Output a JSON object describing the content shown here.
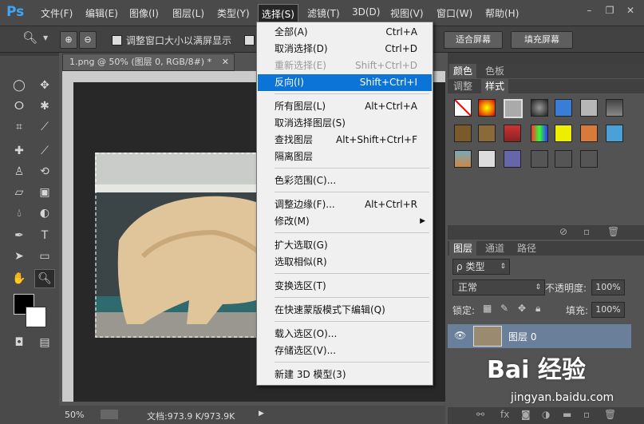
{
  "app": {
    "logo": "Ps"
  },
  "menubar": {
    "items": [
      "文件(F)",
      "编辑(E)",
      "图像(I)",
      "图层(L)",
      "类型(Y)",
      "选择(S)",
      "滤镜(T)",
      "3D(D)",
      "视图(V)",
      "窗口(W)",
      "帮助(H)"
    ]
  },
  "optbar": {
    "fit_label": "调整窗口大小以满屏显示",
    "fill_screen_btn": "适合屏幕",
    "fill_btn": "填充屏幕"
  },
  "document": {
    "tab_title": "1.png @ 50% (图层 0, RGB/8#) *",
    "zoom": "50%",
    "doc_info": "文档:973.9 K/973.9K"
  },
  "select_menu": {
    "items": [
      {
        "label": "全部(A)",
        "shortcut": "Ctrl+A",
        "state": "normal"
      },
      {
        "label": "取消选择(D)",
        "shortcut": "Ctrl+D",
        "state": "normal"
      },
      {
        "label": "重新选择(E)",
        "shortcut": "Shift+Ctrl+D",
        "state": "disabled"
      },
      {
        "label": "反向(I)",
        "shortcut": "Shift+Ctrl+I",
        "state": "highlighted"
      },
      {
        "label": "所有图层(L)",
        "shortcut": "Alt+Ctrl+A",
        "state": "normal"
      },
      {
        "label": "取消选择图层(S)",
        "shortcut": "",
        "state": "normal"
      },
      {
        "label": "查找图层",
        "shortcut": "Alt+Shift+Ctrl+F",
        "state": "normal"
      },
      {
        "label": "隔离图层",
        "shortcut": "",
        "state": "normal"
      },
      {
        "label": "色彩范围(C)...",
        "shortcut": "",
        "state": "normal"
      },
      {
        "label": "调整边缘(F)...",
        "shortcut": "Alt+Ctrl+R",
        "state": "normal"
      },
      {
        "label": "修改(M)",
        "shortcut": "",
        "state": "submenu"
      },
      {
        "label": "扩大选取(G)",
        "shortcut": "",
        "state": "normal"
      },
      {
        "label": "选取相似(R)",
        "shortcut": "",
        "state": "normal"
      },
      {
        "label": "变换选区(T)",
        "shortcut": "",
        "state": "normal"
      },
      {
        "label": "在快速蒙版模式下编辑(Q)",
        "shortcut": "",
        "state": "normal"
      },
      {
        "label": "载入选区(O)...",
        "shortcut": "",
        "state": "normal"
      },
      {
        "label": "存储选区(V)...",
        "shortcut": "",
        "state": "normal"
      },
      {
        "label": "新建 3D 模型(3)",
        "shortcut": "",
        "state": "normal"
      }
    ]
  },
  "panels": {
    "color_tabs": [
      "颜色",
      "色板"
    ],
    "style_tabs": [
      "调整",
      "样式"
    ],
    "layer_tabs": [
      "图层",
      "通道",
      "路径"
    ],
    "filter_kind": "类型",
    "blend_mode": "正常",
    "opacity_label": "不透明度:",
    "opacity_value": "100%",
    "lock_label": "锁定:",
    "fill_label": "填充:",
    "fill_value": "100%",
    "layer_name": "图层 0"
  },
  "watermark": {
    "main": "Bai 经验",
    "sub": "jingyan.baidu.com"
  },
  "colors": {
    "highlight": "#0b74d6",
    "menu_bg": "#f0f0f0",
    "ps_blue": "#3ea6f5"
  }
}
